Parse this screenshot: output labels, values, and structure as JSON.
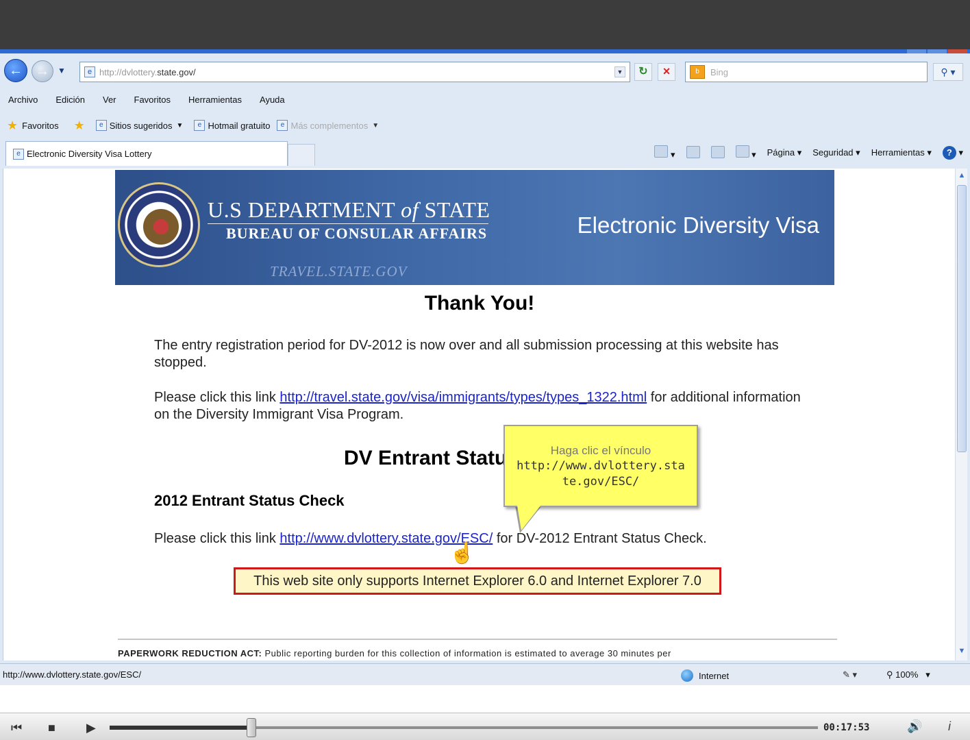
{
  "browser": {
    "url_proto": "http://dvlottery.",
    "url_host": "state.gov/",
    "search_placeholder": "Bing",
    "menu": [
      "Archivo",
      "Edición",
      "Ver",
      "Favoritos",
      "Herramientas",
      "Ayuda"
    ],
    "favorites": {
      "label": "Favoritos",
      "sugeridos": "Sitios sugeridos",
      "hotmail": "Hotmail gratuito",
      "complementos": "Más complementos"
    },
    "tab_title": "Electronic Diversity Visa Lottery",
    "cmd": {
      "pagina": "Página",
      "seguridad": "Seguridad",
      "herramientas": "Herramientas"
    },
    "status": {
      "url": "http://www.dvlottery.state.gov/ESC/",
      "zone": "Internet",
      "zoom": "100%"
    }
  },
  "page": {
    "banner": {
      "dept_pre": "U.S DEPARTMENT ",
      "dept_of": "of",
      "dept_post": " STATE",
      "bureau": "BUREAU OF CONSULAR AFFAIRS",
      "travel": "TRAVEL.STATE.GOV",
      "edv": "Electronic Diversity Visa"
    },
    "title": "Thank You!",
    "p1": "The entry registration period for DV-2012 is now over and all submission processing at this website has stopped.",
    "p2_pre": "Please click this link ",
    "p2_link": "http://travel.state.gov/visa/immigrants/types/types_1322.html",
    "p2_post": " for additional information on the Diversity Immigrant Visa Program.",
    "h2": "DV Entrant Status Check",
    "h3": "2012 Entrant Status Check",
    "p3_pre": "Please click this link ",
    "p3_link": "http://www.dvlottery.state.gov/ESC/",
    "p3_post": " for DV-2012 Entrant Status Check.",
    "warning": "This web site only supports Internet Explorer 6.0 and Internet Explorer 7.0",
    "pra_label": "PAPERWORK REDUCTION ACT:",
    "pra_text": " Public reporting burden for this collection of information is estimated to average 30 minutes per"
  },
  "callout": {
    "line1": "Haga clic el vínculo",
    "line2": "http://www.dvlottery.sta",
    "line3": "te.gov/ESC/"
  },
  "player": {
    "time": "00:17:53",
    "progress": 0.2
  }
}
